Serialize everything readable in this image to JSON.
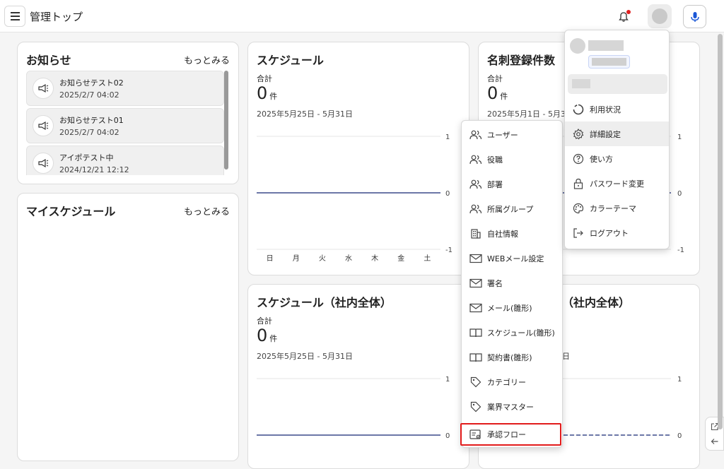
{
  "header": {
    "title": "管理トップ",
    "icons": [
      "menu-icon",
      "bell-icon",
      "user-icon",
      "mic-icon"
    ]
  },
  "news": {
    "title": "お知らせ",
    "more": "もっとみる",
    "items": [
      {
        "title": "お知らせテスト02",
        "date": "2025/2/7 04:02"
      },
      {
        "title": "お知らせテスト01",
        "date": "2025/2/7 04:02"
      },
      {
        "title": "アイポテスト中",
        "date": "2024/12/21 12:12"
      }
    ]
  },
  "my_schedule": {
    "title": "マイスケジュール",
    "more": "もっとみる"
  },
  "schedule": {
    "title": "スケジュール",
    "total_label": "合計",
    "count": "0",
    "unit": "件",
    "range": "2025年5月25日 - 5月31日"
  },
  "cards": {
    "title": "名刺登録件数",
    "total_label": "合計",
    "count": "0",
    "unit": "件",
    "range_visible": "2025年5月1日 - 5月31日"
  },
  "schedule_all": {
    "title": "スケジュール（社内全体）",
    "total_label": "合計",
    "count": "0",
    "unit": "件",
    "range": "2025年5月25日 - 5月31日"
  },
  "second_all": {
    "title_visible": "（社内全体）",
    "range_visible": "日"
  },
  "settings_menu": {
    "items": [
      {
        "label": "ユーザー",
        "icon": "users-icon"
      },
      {
        "label": "役職",
        "icon": "users-icon"
      },
      {
        "label": "部署",
        "icon": "users-icon"
      },
      {
        "label": "所属グループ",
        "icon": "users-icon"
      },
      {
        "label": "自社情報",
        "icon": "building-icon"
      },
      {
        "label": "WEBメール設定",
        "icon": "mail-icon"
      },
      {
        "label": "署名",
        "icon": "mail-icon"
      },
      {
        "label": "メール(雛形)",
        "icon": "mail-icon"
      },
      {
        "label": "スケジュール(雛形)",
        "icon": "book-icon"
      },
      {
        "label": "契約書(雛形)",
        "icon": "book-icon"
      },
      {
        "label": "カテゴリー",
        "icon": "tag-icon"
      },
      {
        "label": "業界マスター",
        "icon": "tag-icon"
      },
      {
        "label": "承認フロー",
        "icon": "approval-icon"
      }
    ],
    "highlighted": "承認フロー"
  },
  "user_menu": {
    "items": [
      {
        "label": "利用状況",
        "icon": "usage-icon"
      },
      {
        "label": "詳細設定",
        "icon": "gear-icon"
      },
      {
        "label": "使い方",
        "icon": "help-icon"
      },
      {
        "label": "パスワード変更",
        "icon": "lock-icon"
      },
      {
        "label": "カラーテーマ",
        "icon": "palette-icon"
      },
      {
        "label": "ログアウト",
        "icon": "logout-icon"
      }
    ],
    "active": "詳細設定"
  },
  "chart_data": [
    {
      "type": "line",
      "title": "スケジュール",
      "categories": [
        "日",
        "月",
        "火",
        "水",
        "木",
        "金",
        "土"
      ],
      "series": [
        {
          "values": [
            0,
            0,
            0,
            0,
            0,
            0,
            0
          ]
        }
      ],
      "yticks": [
        "1",
        "0",
        "-1"
      ],
      "ylim": [
        -1,
        1
      ],
      "grid": true
    },
    {
      "type": "line",
      "title": "名刺登録件数",
      "yticks": [
        "1",
        "0",
        "-1"
      ],
      "ylim": [
        -1,
        1
      ],
      "grid": true
    },
    {
      "type": "line",
      "title": "スケジュール（社内全体）",
      "yticks": [
        "1",
        "0"
      ],
      "series": [
        {
          "values": [
            0,
            0,
            0,
            0,
            0,
            0,
            0
          ]
        }
      ],
      "grid": true
    },
    {
      "type": "line",
      "yticks": [
        "1",
        "0"
      ],
      "grid": true
    }
  ],
  "colors": {
    "accent": "#1a56d6",
    "line": "#3b4a8a",
    "alert": "#e02020",
    "highlight_box": "#e21b1b"
  }
}
